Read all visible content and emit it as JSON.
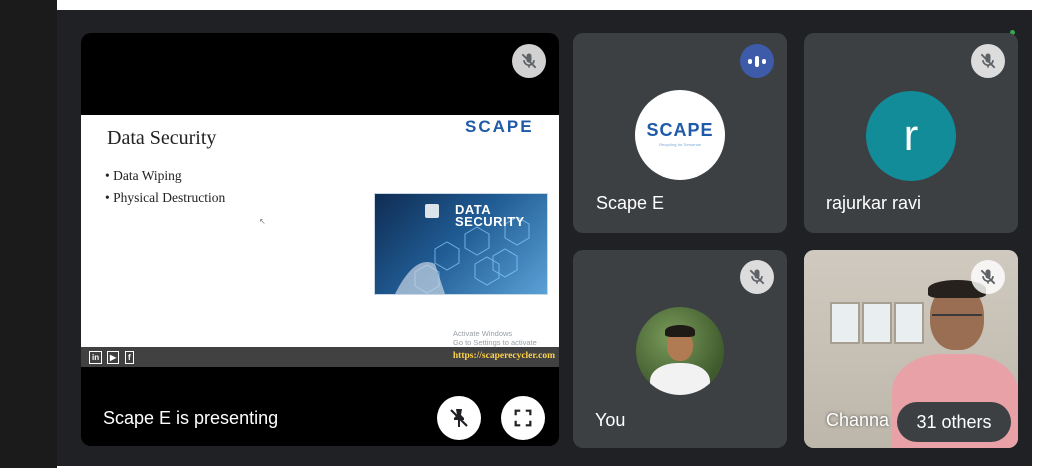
{
  "presentation": {
    "presenting_label": "Scape E is presenting",
    "slide": {
      "title": "Data Security",
      "bullets": [
        "• Data Wiping",
        "• Physical Destruction"
      ],
      "logo": "SCAPE",
      "image_text_line1": "DATA",
      "image_text_line2": "SECURITY",
      "watermark_line1": "Activate Windows",
      "watermark_line2": "Go to Settings to activate Windows.",
      "social": [
        "in",
        "▶",
        "f"
      ],
      "url": "https://scaperecycler.com"
    }
  },
  "participants": {
    "scape": {
      "name": "Scape E",
      "avatar_text": "SCAPE",
      "avatar_subtext": "Recycling for Tomorrow"
    },
    "ravi": {
      "name": "rajurkar ravi",
      "initial": "r"
    },
    "you": {
      "name": "You"
    },
    "channa": {
      "name": "Channa"
    }
  },
  "others": {
    "label": "31 others"
  },
  "colors": {
    "stage": "#202124",
    "tile": "#3c4043",
    "speaking": "#3d5ba9",
    "avatar_teal": "#128c99"
  },
  "icons": [
    "mic-off-icon",
    "speaking-indicator-icon",
    "unpin-icon",
    "fullscreen-icon"
  ]
}
